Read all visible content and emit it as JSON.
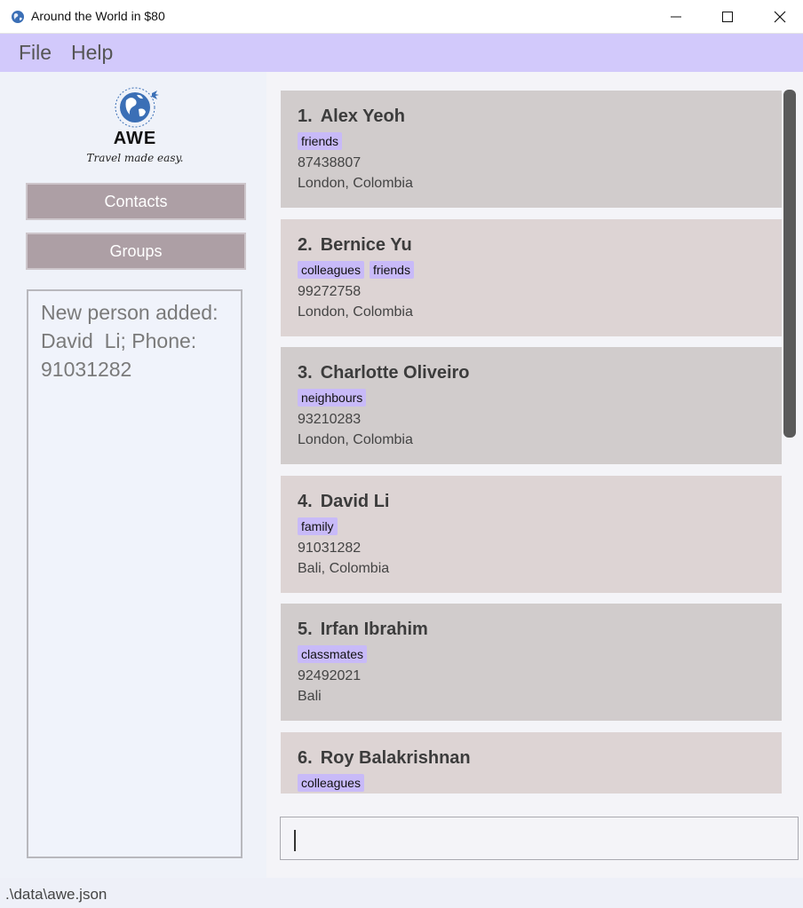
{
  "window": {
    "title": "Around the World in $80",
    "icon": "globe-icon"
  },
  "menu": {
    "items": [
      "File",
      "Help"
    ]
  },
  "sidebar": {
    "logo_word": "AWE",
    "logo_tagline": "Travel made easy.",
    "buttons": [
      "Contacts",
      "Groups"
    ],
    "result_text": "New person added:\nDavid  Li; Phone:\n91031282"
  },
  "contacts": [
    {
      "index": "1.",
      "name": "Alex Yeoh",
      "tags": [
        "friends"
      ],
      "phone": "87438807",
      "address": "London, Colombia"
    },
    {
      "index": "2.",
      "name": "Bernice Yu",
      "tags": [
        "colleagues",
        "friends"
      ],
      "phone": "99272758",
      "address": "London, Colombia"
    },
    {
      "index": "3.",
      "name": "Charlotte Oliveiro",
      "tags": [
        "neighbours"
      ],
      "phone": "93210283",
      "address": "London, Colombia"
    },
    {
      "index": "4.",
      "name": "David Li",
      "tags": [
        "family"
      ],
      "phone": "91031282",
      "address": "Bali, Colombia"
    },
    {
      "index": "5.",
      "name": "Irfan Ibrahim",
      "tags": [
        "classmates"
      ],
      "phone": "92492021",
      "address": "Bali"
    },
    {
      "index": "6.",
      "name": "Roy Balakrishnan",
      "tags": [
        "colleagues"
      ],
      "phone": "",
      "address": ""
    }
  ],
  "command_box": {
    "value": ""
  },
  "status_bar": {
    "path": ".\\data\\awe.json"
  },
  "colors": {
    "menubar": "#d2c9fb",
    "tag": "#c8baf8",
    "button": "#ad9fa5",
    "card_odd": "#d1cccc",
    "card_even": "#ddd4d4"
  }
}
